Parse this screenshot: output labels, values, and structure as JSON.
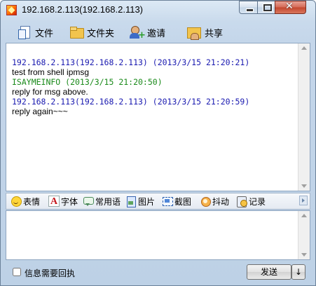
{
  "window": {
    "title": "192.168.2.113(192.168.2.113)"
  },
  "toolbar": {
    "file_label": "文件",
    "folder_label": "文件夹",
    "invite_label": "邀请",
    "share_label": "共享"
  },
  "messages": [
    {
      "header": "192.168.2.113(192.168.2.113) (2013/3/15 21:20:21)",
      "header_color": "#1a1ab0",
      "text": "test from shell ipmsg"
    },
    {
      "header": "ISAYMEINFO (2013/3/15 21:20:50)",
      "header_color": "#1a8a1a",
      "text": "reply for msg above."
    },
    {
      "header": "192.168.2.113(192.168.2.113) (2013/3/15 21:20:59)",
      "header_color": "#1a1ab0",
      "text": "reply again~~~"
    }
  ],
  "emobar": {
    "emoji_label": "表情",
    "font_label": "字体",
    "phrase_label": "常用语",
    "image_label": "图片",
    "screenshot_label": "截图",
    "shake_label": "抖动",
    "record_label": "记录"
  },
  "bottom": {
    "receipt_label": "信息需要回执",
    "send_label": "发送",
    "send_dropdown": "↓"
  }
}
